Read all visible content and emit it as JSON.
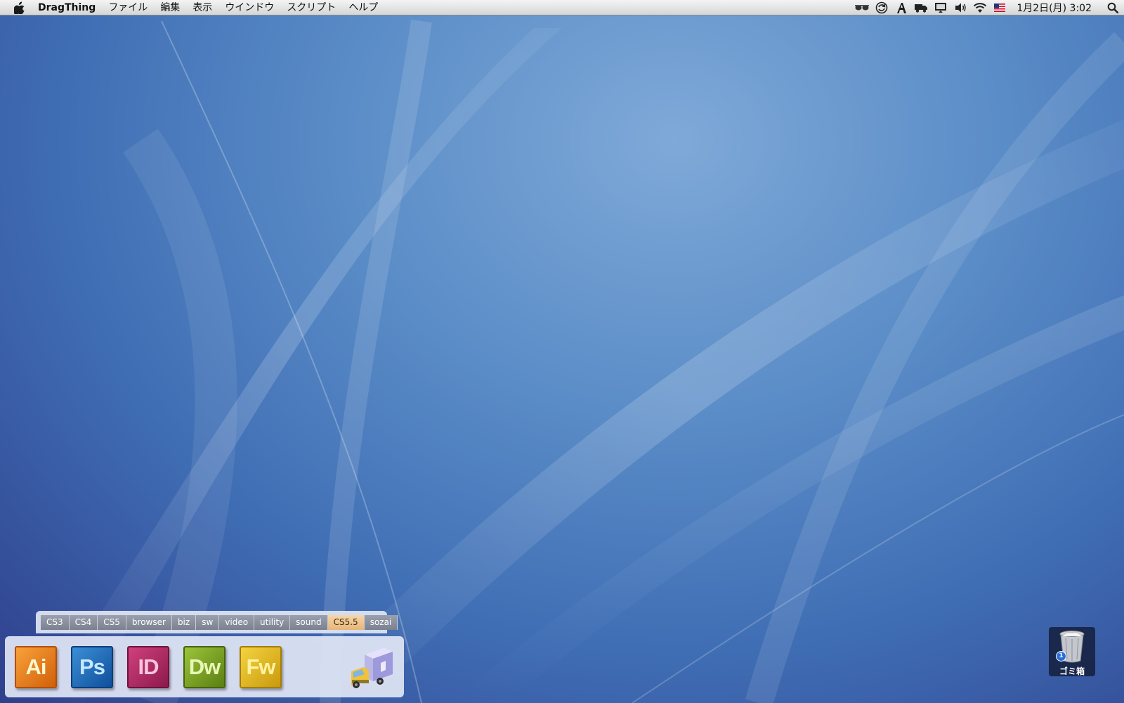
{
  "menubar": {
    "app_name": "DragThing",
    "menus": [
      "ファイル",
      "編集",
      "表示",
      "ウインドウ",
      "スクリプト",
      "ヘルプ"
    ],
    "status_icons": [
      "glasses-icon",
      "sync-icon",
      "font-a-icon",
      "truck-icon",
      "display-icon",
      "volume-icon",
      "wifi-icon",
      "us-flag-icon"
    ],
    "clock": "1月2日(月)  3:02"
  },
  "dock": {
    "tabs": [
      {
        "label": "CS3",
        "active": false
      },
      {
        "label": "CS4",
        "active": false
      },
      {
        "label": "CS5",
        "active": false
      },
      {
        "label": "browser",
        "active": false
      },
      {
        "label": "biz",
        "active": false
      },
      {
        "label": "sw",
        "active": false
      },
      {
        "label": "video",
        "active": false
      },
      {
        "label": "utility",
        "active": false
      },
      {
        "label": "sound",
        "active": false
      },
      {
        "label": "CS5.5",
        "active": true
      },
      {
        "label": "sozai",
        "active": false
      }
    ],
    "apps": [
      {
        "abbr": "Ai",
        "icon": "illustrator-icon"
      },
      {
        "abbr": "Ps",
        "icon": "photoshop-icon"
      },
      {
        "abbr": "ID",
        "icon": "indesign-icon"
      },
      {
        "abbr": "Dw",
        "icon": "dreamweaver-icon"
      },
      {
        "abbr": "Fw",
        "icon": "fireworks-icon"
      }
    ]
  },
  "trash": {
    "label": "ゴミ箱",
    "badge": "1"
  },
  "colors": {
    "active_tab": "#e7b579",
    "inactive_tab": "#7b818f",
    "wallpaper": "#4f7fc0"
  }
}
